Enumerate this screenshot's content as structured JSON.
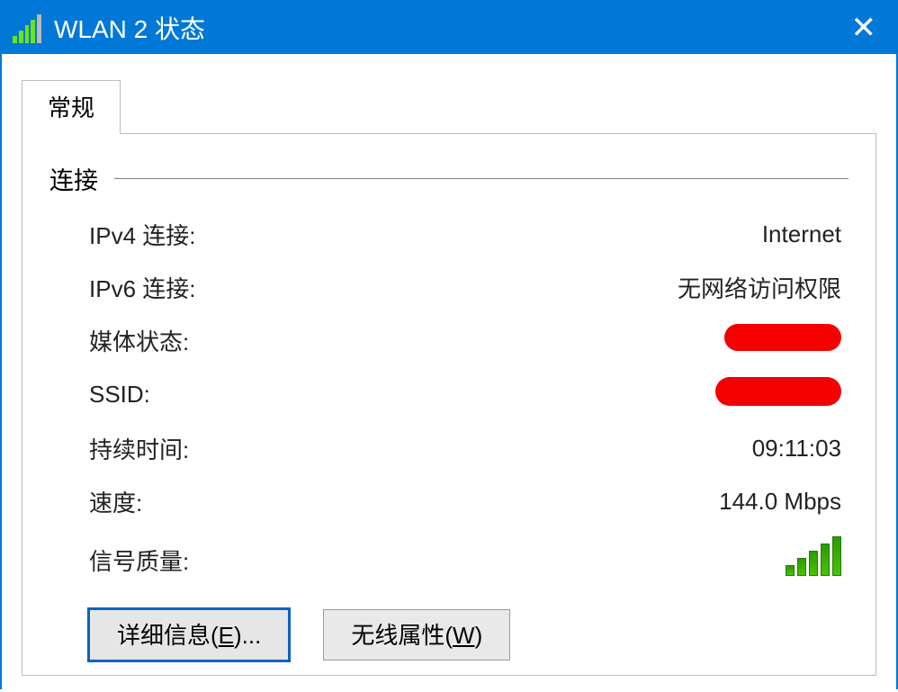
{
  "window": {
    "title": "WLAN 2 状态"
  },
  "tabs": {
    "general": "常规"
  },
  "group": {
    "connection": "连接"
  },
  "rows": {
    "ipv4": {
      "label": "IPv4 连接:",
      "value": "Internet"
    },
    "ipv6": {
      "label": "IPv6 连接:",
      "value": "无网络访问权限"
    },
    "media": {
      "label": "媒体状态:"
    },
    "ssid": {
      "label": "SSID:"
    },
    "duration": {
      "label": "持续时间:",
      "value": "09:11:03"
    },
    "speed": {
      "label": "速度:",
      "value": "144.0 Mbps"
    },
    "signal": {
      "label": "信号质量:"
    }
  },
  "buttons": {
    "details_prefix": "详细信息(",
    "details_key": "E",
    "details_suffix": ")...",
    "wireless_prefix": "无线属性(",
    "wireless_key": "W",
    "wireless_suffix": ")"
  }
}
